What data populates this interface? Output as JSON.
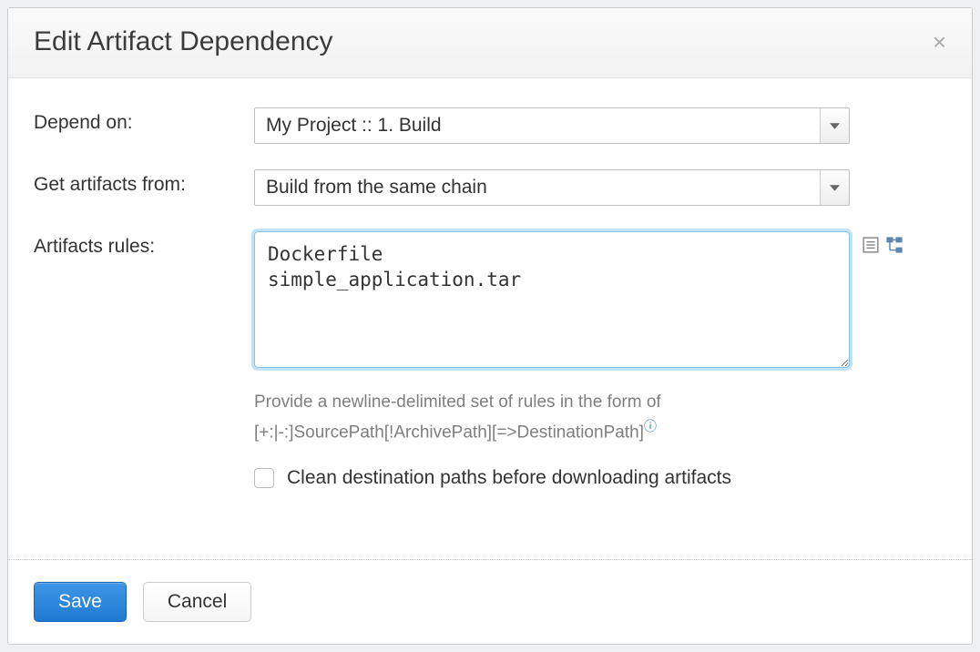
{
  "dialog": {
    "title": "Edit Artifact Dependency",
    "close_symbol": "×"
  },
  "fields": {
    "depend_on": {
      "label": "Depend on:",
      "value": "My Project :: 1. Build"
    },
    "get_from": {
      "label": "Get artifacts from:",
      "value": "Build from the same chain"
    },
    "rules": {
      "label": "Artifacts rules:",
      "value": "Dockerfile\nsimple_application.tar",
      "hint_line1": "Provide a newline-delimited set of rules in the form of",
      "hint_line2": "[+:|-:]SourcePath[!ArchivePath][=>DestinationPath]",
      "help_symbol": "?"
    },
    "clean": {
      "label": "Clean destination paths before downloading artifacts",
      "checked": false
    }
  },
  "buttons": {
    "save": "Save",
    "cancel": "Cancel"
  }
}
